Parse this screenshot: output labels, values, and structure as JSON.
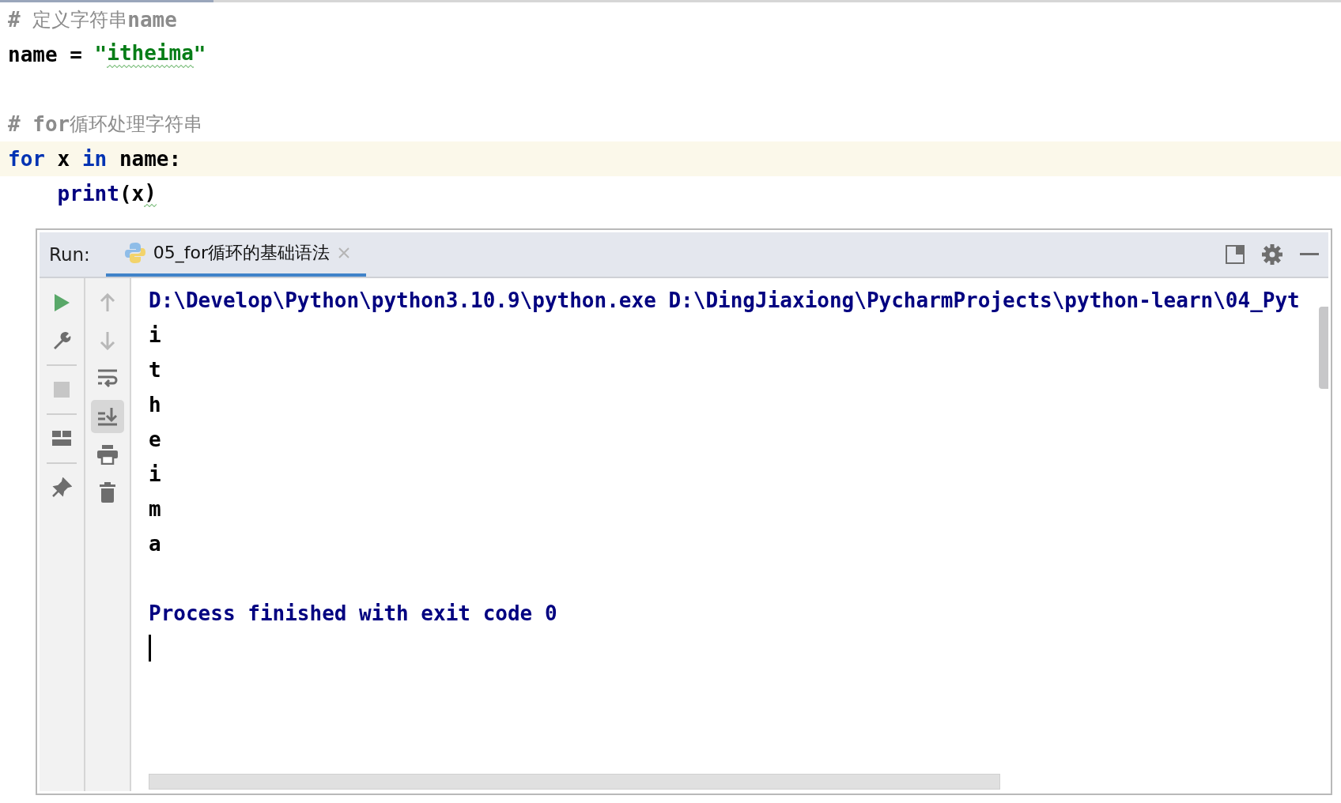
{
  "editor": {
    "lines": [
      {
        "kind": "code",
        "current": false,
        "tokens": [
          {
            "kind": "comment",
            "text": "# "
          },
          {
            "kind": "comment_cjk",
            "text": "定义字符串"
          },
          {
            "kind": "comment",
            "text": "name"
          }
        ]
      },
      {
        "kind": "code",
        "current": false,
        "tokens": [
          {
            "kind": "plain",
            "text": "name = "
          },
          {
            "kind": "string",
            "text": "\""
          },
          {
            "kind": "string",
            "text": "itheima",
            "squiggle": true
          },
          {
            "kind": "string",
            "text": "\""
          }
        ]
      },
      {
        "kind": "blank"
      },
      {
        "kind": "code",
        "current": false,
        "tokens": [
          {
            "kind": "comment",
            "text": "# for"
          },
          {
            "kind": "comment_cjk",
            "text": "循环处理字符串"
          }
        ]
      },
      {
        "kind": "code",
        "current": true,
        "tokens": [
          {
            "kind": "keyword",
            "text": "for"
          },
          {
            "kind": "plain",
            "text": " x "
          },
          {
            "kind": "keyword",
            "text": "in"
          },
          {
            "kind": "plain",
            "text": " name:"
          }
        ]
      },
      {
        "kind": "code",
        "current": false,
        "tokens": [
          {
            "kind": "builtin",
            "text": "    print"
          },
          {
            "kind": "plain",
            "text": "(x"
          },
          {
            "kind": "plain",
            "text": ")",
            "squiggle": true
          }
        ]
      }
    ]
  },
  "run_panel": {
    "label": "Run:",
    "tabs": [
      {
        "title": "05_for循环的基础语法",
        "selected": true
      }
    ],
    "left_tools": [
      {
        "kind": "run",
        "disabled": false
      },
      {
        "kind": "wrench",
        "disabled": false
      },
      {
        "kind": "separator"
      },
      {
        "kind": "stop",
        "disabled": true
      },
      {
        "kind": "separator"
      },
      {
        "kind": "layout",
        "disabled": false
      },
      {
        "kind": "separator"
      },
      {
        "kind": "pin",
        "disabled": false
      }
    ],
    "right_tools": [
      {
        "kind": "up",
        "disabled": true,
        "selected": false
      },
      {
        "kind": "down",
        "disabled": true,
        "selected": false
      },
      {
        "kind": "wrap",
        "disabled": false,
        "selected": false
      },
      {
        "kind": "scroll_end",
        "disabled": false,
        "selected": true
      },
      {
        "kind": "print",
        "disabled": false,
        "selected": false
      },
      {
        "kind": "trash",
        "disabled": false,
        "selected": false
      }
    ],
    "console": [
      {
        "kind": "system",
        "text": "D:\\Develop\\Python\\python3.10.9\\python.exe D:\\DingJiaxiong\\PycharmProjects\\python-learn\\04_Pyt"
      },
      {
        "kind": "output",
        "text": "i"
      },
      {
        "kind": "output",
        "text": "t"
      },
      {
        "kind": "output",
        "text": "h"
      },
      {
        "kind": "output",
        "text": "e"
      },
      {
        "kind": "output",
        "text": "i"
      },
      {
        "kind": "output",
        "text": "m"
      },
      {
        "kind": "output",
        "text": "a"
      },
      {
        "kind": "blank"
      },
      {
        "kind": "system",
        "text": "Process finished with exit code 0"
      },
      {
        "kind": "caret"
      }
    ]
  }
}
